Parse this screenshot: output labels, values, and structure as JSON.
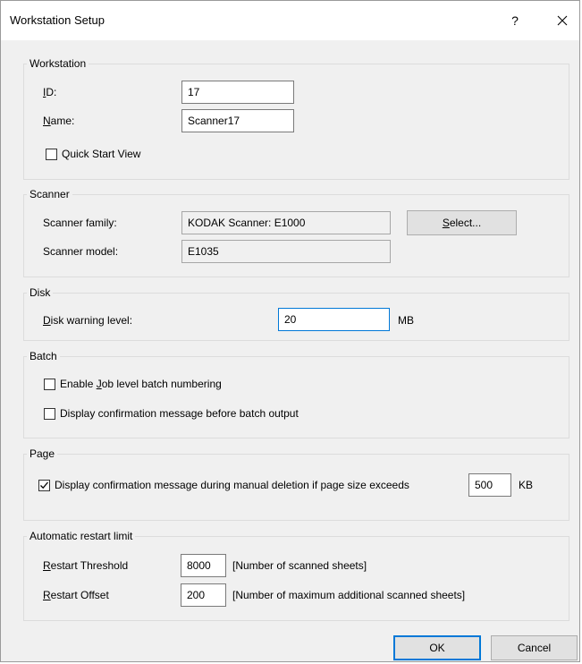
{
  "window": {
    "title": "Workstation Setup",
    "help_glyph": "?"
  },
  "workstation": {
    "legend": "Workstation",
    "id_label": {
      "hot": "I",
      "rest": "D:"
    },
    "id_value": "17",
    "name_label": {
      "hot": "N",
      "rest": "ame:"
    },
    "name_value": "Scanner17",
    "quick_start_label": "Quick Start View",
    "quick_start_checked": false
  },
  "scanner": {
    "legend": "Scanner",
    "family_label": "Scanner family:",
    "family_value": "KODAK Scanner: E1000",
    "select_button": {
      "hot": "S",
      "rest": "elect..."
    },
    "model_label": "Scanner model:",
    "model_value": "E1035"
  },
  "disk": {
    "legend": "Disk",
    "warning_label": {
      "hot": "D",
      "rest": "isk warning level:"
    },
    "warning_value": "20",
    "unit": "MB"
  },
  "batch": {
    "legend": "Batch",
    "job_level": {
      "before": "Enable ",
      "hot": "J",
      "after": "ob level batch numbering",
      "checked": false
    },
    "confirm_output": {
      "label": "Display confirmation message before batch output",
      "checked": false
    }
  },
  "page": {
    "legend": "Page",
    "confirm_delete_label": "Display confirmation message during manual deletion if page size exceeds",
    "confirm_delete_checked": true,
    "size_value": "500",
    "unit": "KB"
  },
  "restart": {
    "legend": "Automatic restart limit",
    "threshold_label": {
      "hot": "R",
      "rest": "estart Threshold"
    },
    "threshold_value": "8000",
    "threshold_hint": "[Number of scanned sheets]",
    "offset_label": {
      "hot": "R",
      "rest": "estart Offset"
    },
    "offset_value": "200",
    "offset_hint": "[Number of maximum additional scanned sheets]"
  },
  "buttons": {
    "ok": "OK",
    "cancel": "Cancel"
  }
}
